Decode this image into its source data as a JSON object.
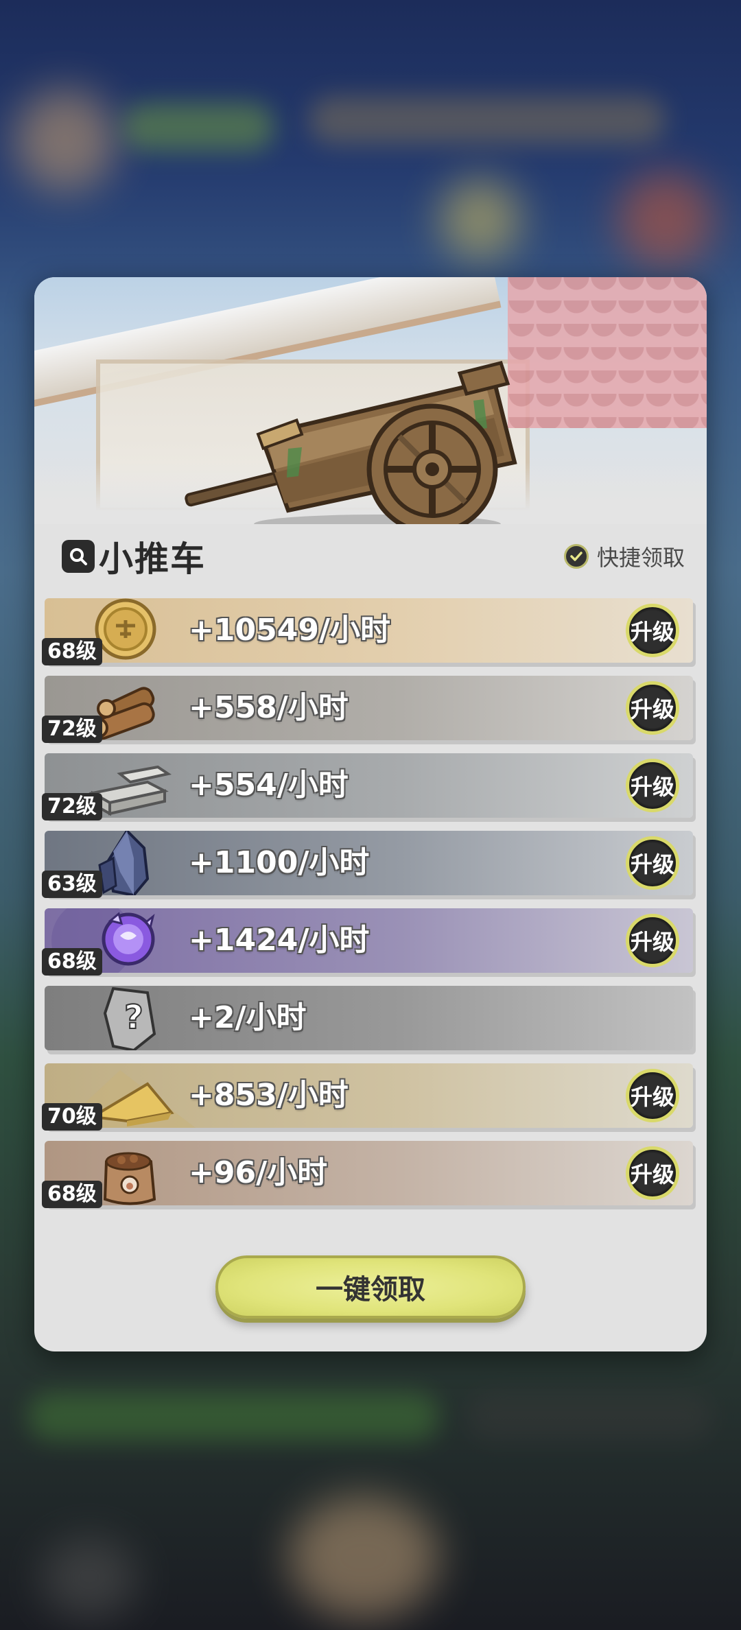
{
  "panel": {
    "title": "小推车",
    "quick_claim_label": "快捷领取",
    "claim_all_label": "一键领取"
  },
  "rows": [
    {
      "resource": "coin-icon",
      "level": "68级",
      "rate": "+10549/小时",
      "upgrade_label": "升级",
      "color": "#cdb28a"
    },
    {
      "resource": "wood-icon",
      "level": "72级",
      "rate": "+558/小时",
      "upgrade_label": "升级",
      "color": "#9c9c9c"
    },
    {
      "resource": "stone-icon",
      "level": "72级",
      "rate": "+554/小时",
      "upgrade_label": "升级",
      "color": "#979a9e"
    },
    {
      "resource": "crystal-icon",
      "level": "63级",
      "rate": "+1100/小时",
      "upgrade_label": "升级",
      "color": "#7e8894"
    },
    {
      "resource": "orb-icon",
      "level": "68级",
      "rate": "+1424/小时",
      "upgrade_label": "升级",
      "color": "#8a7fa6"
    },
    {
      "resource": "unknown-icon",
      "level": "",
      "rate": "+2/小时",
      "upgrade_label": "",
      "color": "#8a8a8a"
    },
    {
      "resource": "sand-icon",
      "level": "70级",
      "rate": "+853/小时",
      "upgrade_label": "升级",
      "color": "#c5b68e"
    },
    {
      "resource": "seed-bag-icon",
      "level": "68级",
      "rate": "+96/小时",
      "upgrade_label": "升级",
      "color": "#b5a08d"
    }
  ]
}
